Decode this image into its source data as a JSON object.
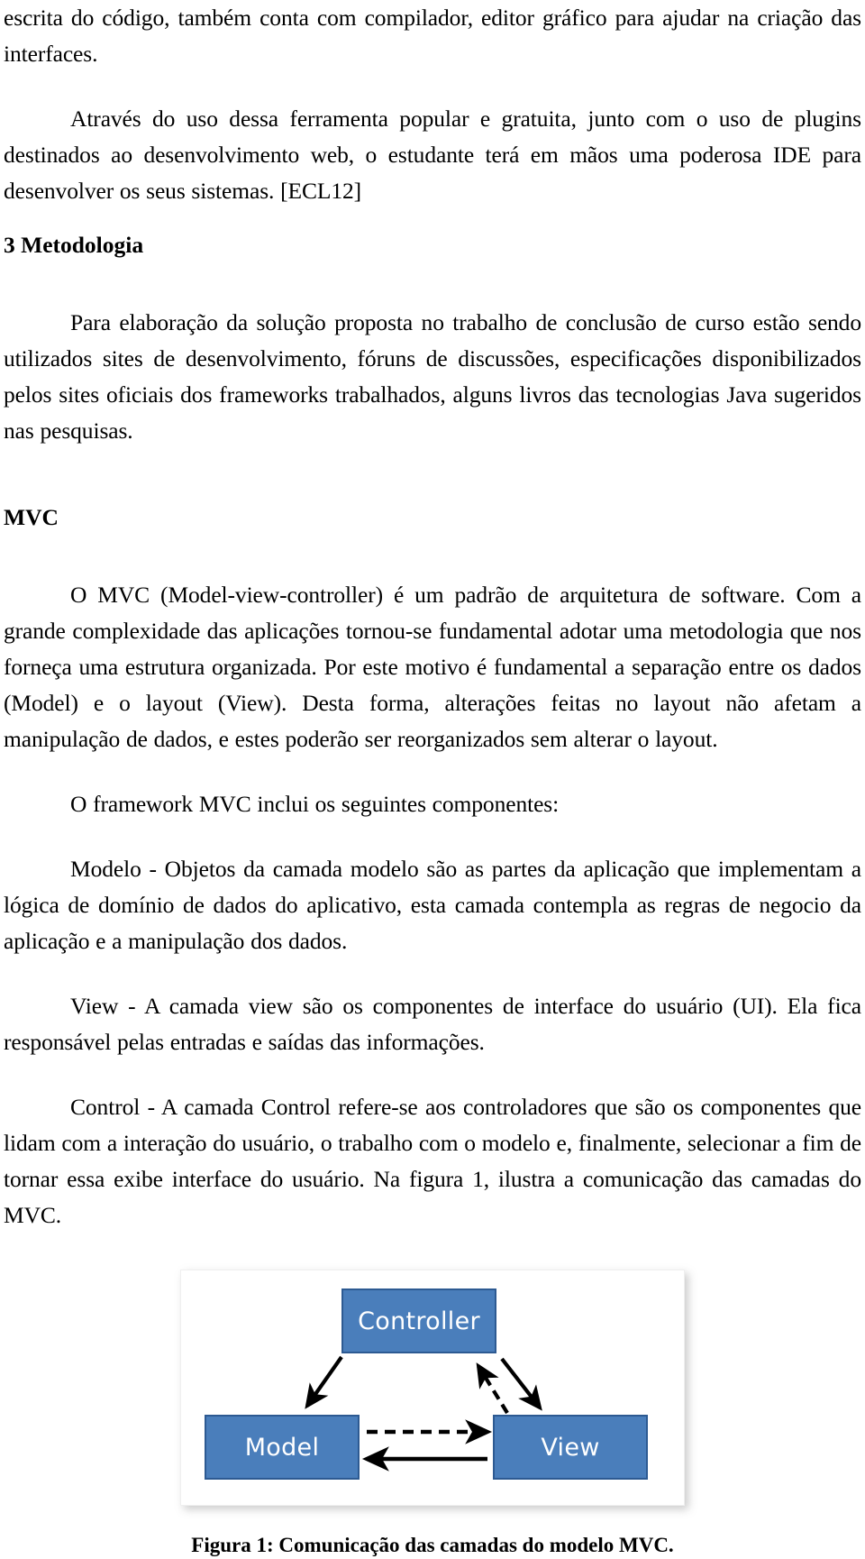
{
  "document": {
    "language": "pt-BR",
    "paragraphs": {
      "p_intro_cont": "escrita do código, também conta com compilador, editor gráfico para ajudar na criação das interfaces.",
      "p_plugins": "Através do uso dessa ferramenta popular e gratuita, junto com o uso de plugins destinados ao desenvolvimento web, o estudante terá em mãos uma poderosa IDE para desenvolver os seus sistemas. [ECL12]",
      "p_metodologia": "Para elaboração da solução proposta no trabalho de conclusão de curso estão sendo utilizados sites de desenvolvimento, fóruns de discussões, especificações disponibilizados pelos sites oficiais dos frameworks trabalhados, alguns livros das tecnologias Java sugeridos nas pesquisas.",
      "p_mvc_intro": "O MVC (Model-view-controller) é um padrão de arquitetura de software.  Com a grande complexidade das aplicações tornou-se fundamental adotar uma metodologia que nos forneça uma estrutura organizada. Por este motivo é fundamental a separação entre os dados (Model) e o layout (View). Desta forma, alterações feitas no layout não afetam a manipulação de dados, e estes poderão ser reorganizados sem alterar o layout.",
      "p_components_lead": "O framework MVC inclui os seguintes componentes:",
      "p_modelo": "Modelo - Objetos da camada modelo são as partes da aplicação que implementam a lógica de domínio de dados do aplicativo, esta camada contempla as regras de negocio da aplicação e a manipulação dos dados.",
      "p_view": "View - A camada view são os componentes de interface do usuário (UI).  Ela fica responsável pelas entradas e saídas das informações.",
      "p_control": "Control - A camada Control refere-se aos controladores que são os componentes que lidam com a interação do usuário, o trabalho com o modelo e, finalmente, selecionar a fim de tornar essa exibe interface do usuário.  Na figura 1,  ilustra a comunicação das camadas do MVC."
    },
    "headings": {
      "h_metodologia": "3 Metodologia",
      "h_mvc": "MVC"
    },
    "figure": {
      "caption": "Figura 1: Comunicação das camadas do modelo MVC.",
      "nodes": {
        "controller": "Controller",
        "model": "Model",
        "view": "View"
      },
      "colors": {
        "node_fill": "#4a7ebb",
        "node_border": "#2d5a92",
        "node_text": "#ffffff",
        "arrow": "#000000",
        "frame_background": "#ffffff"
      },
      "connections": [
        {
          "from": "Controller",
          "to": "Model",
          "style": "solid"
        },
        {
          "from": "Controller",
          "to": "View",
          "style": "solid"
        },
        {
          "from": "View",
          "to": "Controller",
          "style": "dashed"
        },
        {
          "from": "Model",
          "to": "View",
          "style": "dashed"
        },
        {
          "from": "View",
          "to": "Model",
          "style": "solid"
        }
      ]
    }
  }
}
